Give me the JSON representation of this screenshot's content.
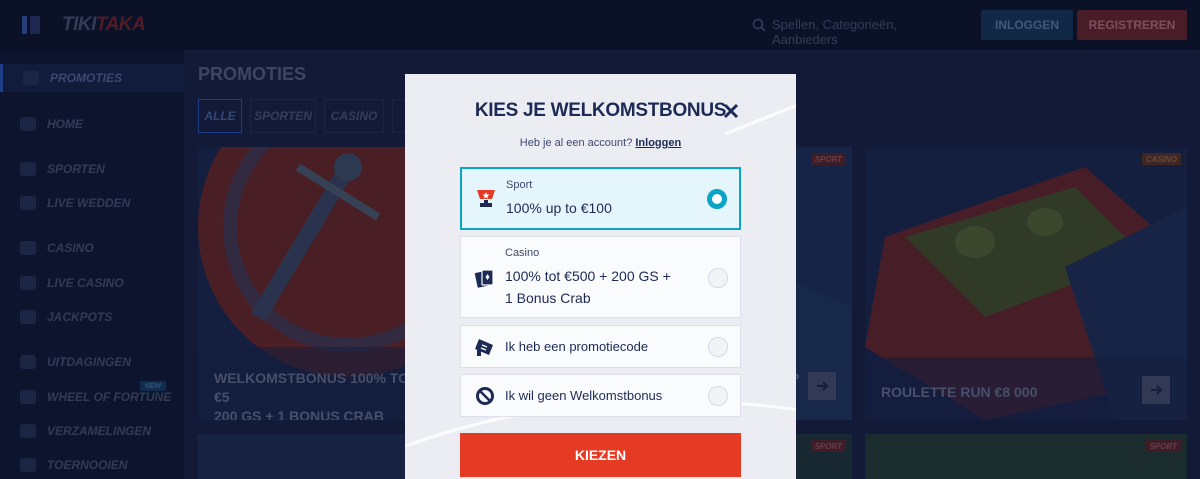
{
  "app": {
    "logo_a": "TIKI",
    "logo_b": "TAKA",
    "search_placeholder": "Spellen, Categorieën, Aanbieders",
    "login_label": "INLOGGEN",
    "register_label": "REGISTREREN"
  },
  "sidebar": {
    "items": [
      {
        "label": "PROMOTIES"
      },
      {
        "label": "HOME"
      },
      {
        "label": "SPORTEN"
      },
      {
        "label": "LIVE WEDDEN"
      },
      {
        "label": "CASINO"
      },
      {
        "label": "LIVE CASINO"
      },
      {
        "label": "JACKPOTS"
      },
      {
        "label": "UITDAGINGEN"
      },
      {
        "label": "WHEEL OF FORTUNE"
      },
      {
        "label": "VERZAMELINGEN"
      },
      {
        "label": "TOERNOOIEN"
      }
    ],
    "new_badge": "NEW"
  },
  "main": {
    "title": "PROMOTIES",
    "filters": [
      "ALLE",
      "SPORTEN",
      "CASINO",
      "S"
    ],
    "cards": [
      {
        "title_line1": "WELKOMSTBONUS 100% TOT €5",
        "title_line2": "200 GS + 1 BONUS CRAB"
      },
      {
        "title": "P",
        "tag": "SPORT"
      },
      {
        "title": "ROULETTE RUN €8 000",
        "tag": "CASINO"
      },
      {
        "tag": "SPORT"
      },
      {
        "tag": "SPORT"
      }
    ]
  },
  "modal": {
    "title": "KIES JE WELKOMSTBONUS",
    "subtitle": "Heb je al een account?",
    "subtitle_link": "Inloggen",
    "options": [
      {
        "category": "Sport",
        "text": "100% up to €100",
        "selected": true
      },
      {
        "category": "Casino",
        "text_line1": "100% tot €500 + 200 GS +",
        "text_line2": "1 Bonus Crab",
        "selected": false
      },
      {
        "text": "Ik heb een promotiecode",
        "selected": false
      },
      {
        "text": "Ik wil geen Welkomstbonus",
        "selected": false
      }
    ],
    "submit_label": "KIEZEN"
  },
  "colors": {
    "accent_cyan": "#0aa4c4",
    "submit_red": "#e53b24",
    "navy_text": "#1d2a55"
  }
}
